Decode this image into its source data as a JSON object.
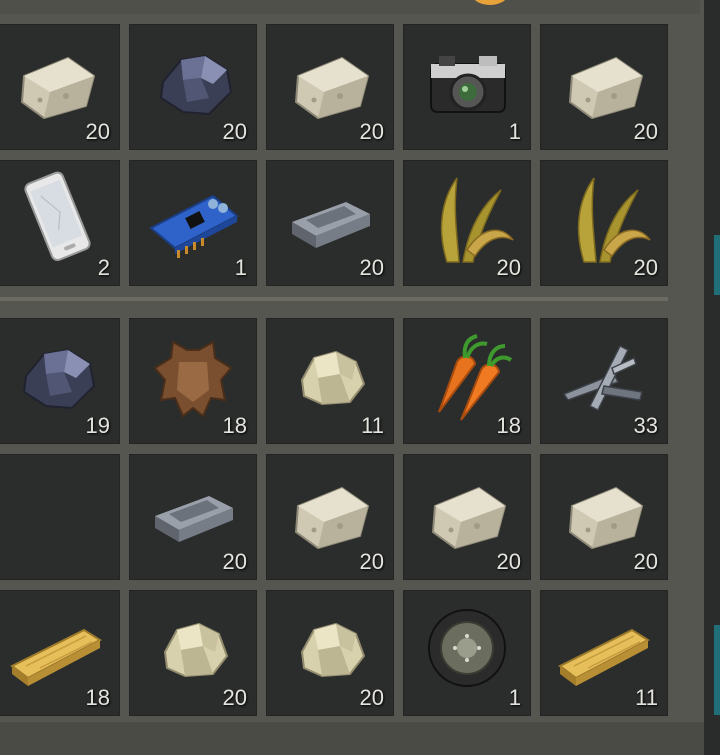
{
  "colors": {
    "background": "#55564f",
    "slot": "#2b2d2c",
    "quantity_text": "#e4e4df",
    "accent": "#1f6f78"
  },
  "sections": [
    {
      "rows": [
        [
          {
            "icon": "stone-block-icon",
            "qty": "20"
          },
          {
            "icon": "coal-ore-icon",
            "qty": "20"
          },
          {
            "icon": "stone-block-icon",
            "qty": "20"
          },
          {
            "icon": "camera-icon",
            "qty": "1"
          },
          {
            "icon": "stone-block-icon",
            "qty": "20"
          }
        ],
        [
          {
            "icon": "smartphone-icon",
            "qty": "2"
          },
          {
            "icon": "circuit-board-icon",
            "qty": "1"
          },
          {
            "icon": "iron-ingot-icon",
            "qty": "20"
          },
          {
            "icon": "plant-fiber-icon",
            "qty": "20"
          },
          {
            "icon": "plant-fiber-icon",
            "qty": "20"
          }
        ]
      ]
    },
    {
      "rows": [
        [
          {
            "icon": "coal-ore-icon",
            "qty": "19"
          },
          {
            "icon": "animal-hide-icon",
            "qty": "18"
          },
          {
            "icon": "rock-icon",
            "qty": "11"
          },
          {
            "icon": "carrot-icon",
            "qty": "18"
          },
          {
            "icon": "scrap-metal-icon",
            "qty": "33"
          }
        ],
        [
          {
            "icon": "",
            "qty": ""
          },
          {
            "icon": "iron-ingot-icon",
            "qty": "20"
          },
          {
            "icon": "stone-block-icon",
            "qty": "20"
          },
          {
            "icon": "stone-block-icon",
            "qty": "20"
          },
          {
            "icon": "stone-block-icon",
            "qty": "20"
          }
        ],
        [
          {
            "icon": "wooden-plank-icon",
            "qty": "18"
          },
          {
            "icon": "rock-icon",
            "qty": "20"
          },
          {
            "icon": "rock-icon",
            "qty": "20"
          },
          {
            "icon": "wheel-icon",
            "qty": "1"
          },
          {
            "icon": "wooden-plank-icon",
            "qty": "11"
          }
        ]
      ]
    }
  ]
}
